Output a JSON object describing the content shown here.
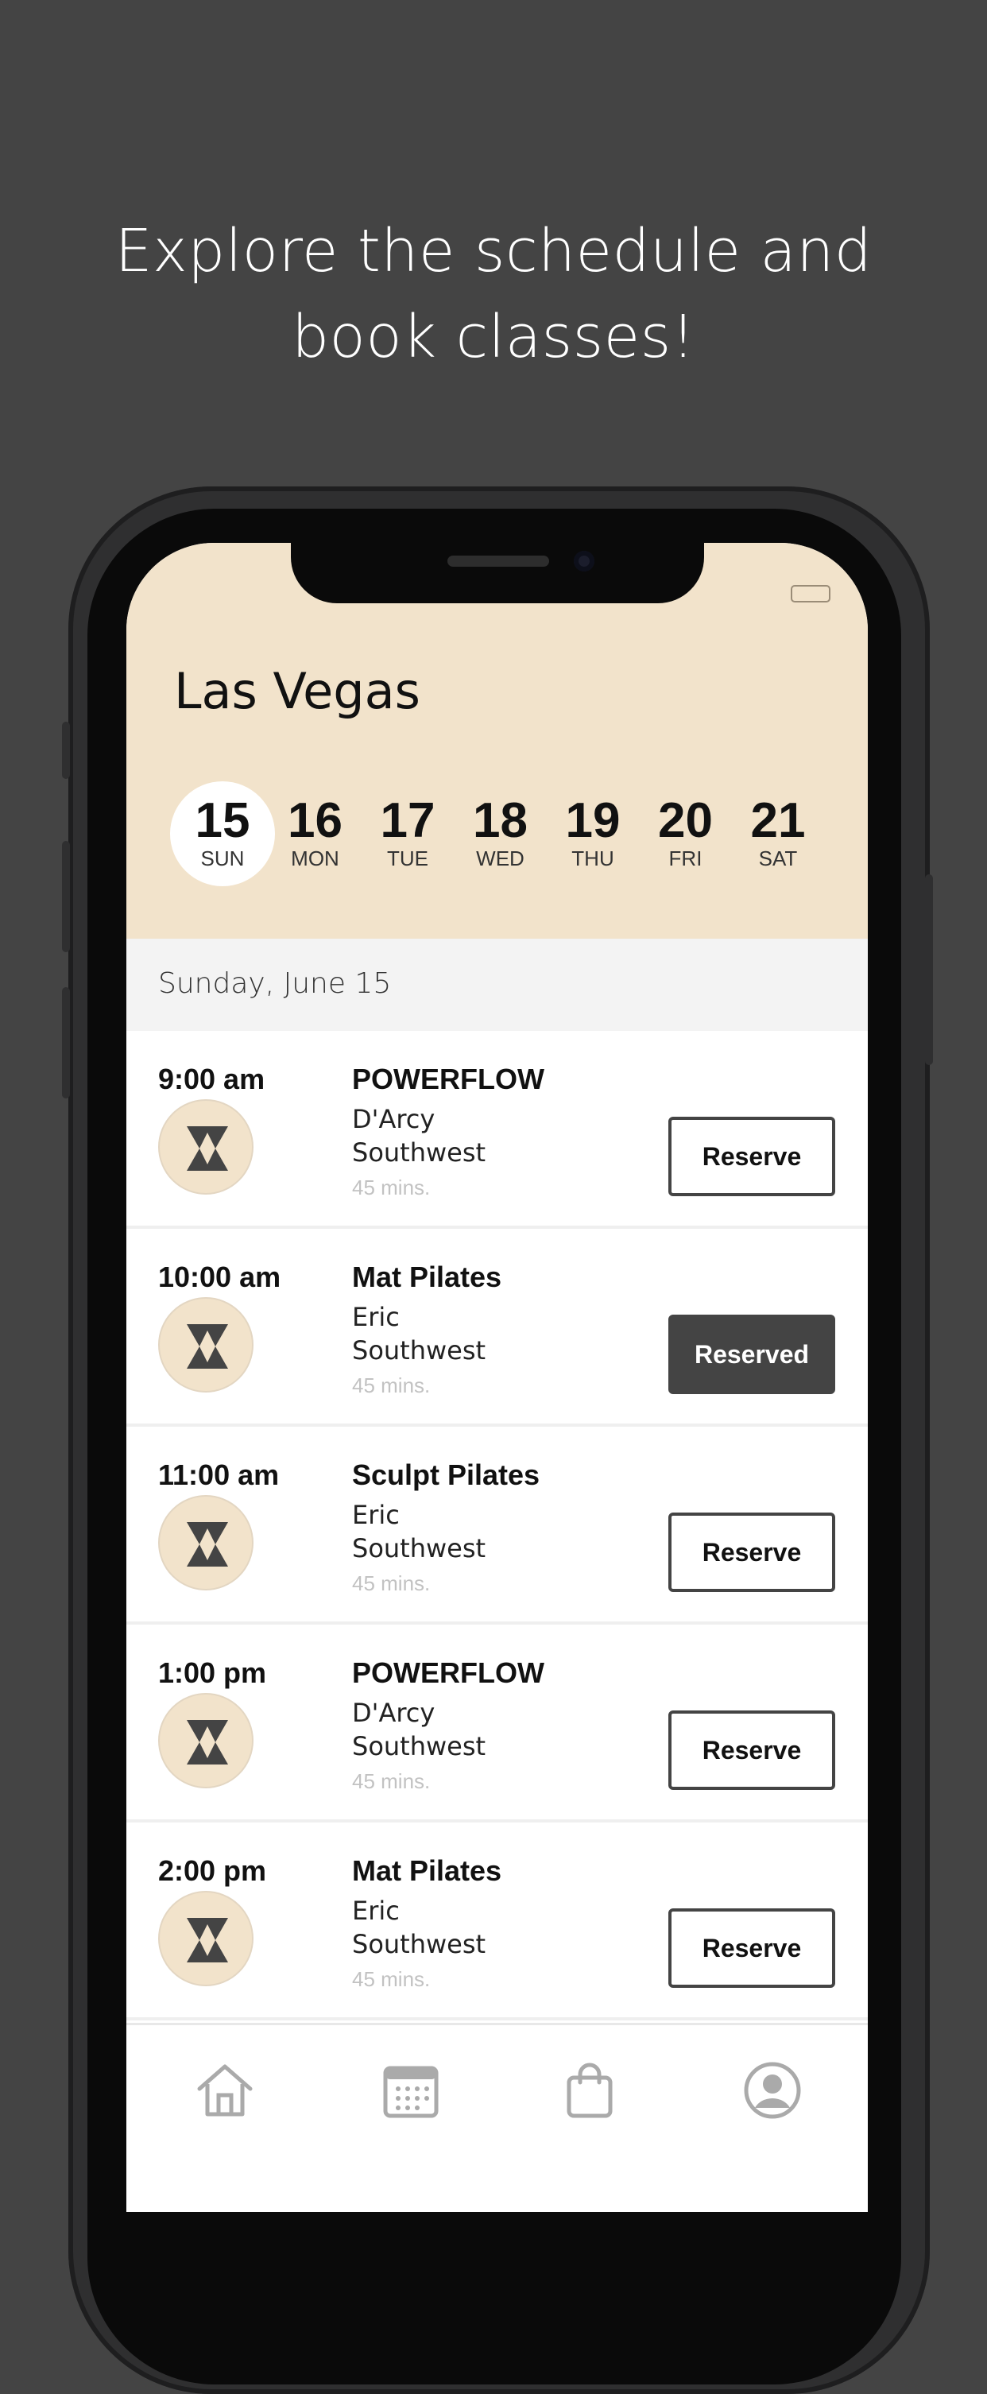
{
  "headline": {
    "line1": "Explore the schedule and",
    "line2": "book classes!"
  },
  "header": {
    "city": "Las Vegas"
  },
  "week": [
    {
      "num": "15",
      "label": "SUN",
      "selected": true
    },
    {
      "num": "16",
      "label": "MON",
      "selected": false
    },
    {
      "num": "17",
      "label": "TUE",
      "selected": false
    },
    {
      "num": "18",
      "label": "WED",
      "selected": false
    },
    {
      "num": "19",
      "label": "THU",
      "selected": false
    },
    {
      "num": "20",
      "label": "FRI",
      "selected": false
    },
    {
      "num": "21",
      "label": "SAT",
      "selected": false
    }
  ],
  "selected_date": "Sunday, June 15",
  "classes": [
    {
      "time": "9:00 am",
      "name": "POWERFLOW",
      "instructor": "D'Arcy",
      "location": "Southwest",
      "duration": "45 mins.",
      "button": "Reserve",
      "reserved": false
    },
    {
      "time": "10:00 am",
      "name": "Mat Pilates",
      "instructor": "Eric",
      "location": "Southwest",
      "duration": "45 mins.",
      "button": "Reserved",
      "reserved": true
    },
    {
      "time": "11:00 am",
      "name": "Sculpt Pilates",
      "instructor": "Eric",
      "location": "Southwest",
      "duration": "45 mins.",
      "button": "Reserve",
      "reserved": false
    },
    {
      "time": "1:00 pm",
      "name": "POWERFLOW",
      "instructor": "D'Arcy",
      "location": "Southwest",
      "duration": "45 mins.",
      "button": "Reserve",
      "reserved": false
    },
    {
      "time": "2:00 pm",
      "name": "Mat Pilates",
      "instructor": "Eric",
      "location": "Southwest",
      "duration": "45 mins.",
      "button": "Reserve",
      "reserved": false
    }
  ],
  "tabbar": {
    "icons": [
      "home-icon",
      "calendar-icon",
      "shopping-bag-icon",
      "profile-icon"
    ]
  },
  "colors": {
    "background": "#444444",
    "header": "#f2e3cb",
    "reserved_button": "#444444"
  }
}
